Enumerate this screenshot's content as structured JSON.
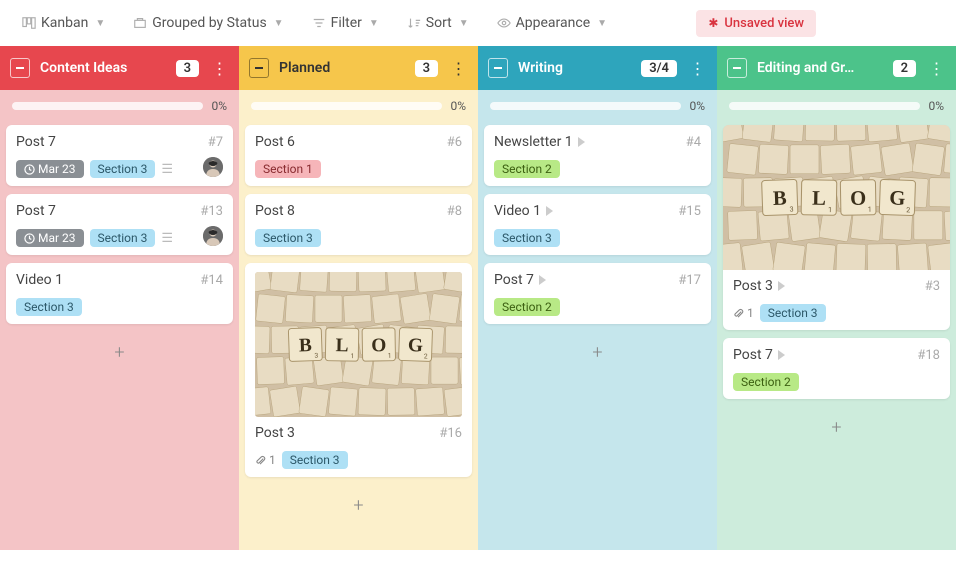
{
  "toolbar": {
    "view_type": "Kanban",
    "group_by": "Grouped by Status",
    "filter": "Filter",
    "sort": "Sort",
    "appearance": "Appearance",
    "unsaved": "Unsaved view"
  },
  "columns": [
    {
      "title": "Content Ideas",
      "count": "3",
      "progress": "0%",
      "color": "red",
      "cards": [
        {
          "title": "Post 7",
          "num": "#7",
          "date": "Mar 23",
          "section": "Section 3",
          "section_color": "blue",
          "desc": true,
          "avatar": true
        },
        {
          "title": "Post 7",
          "num": "#13",
          "date": "Mar 23",
          "section": "Section 3",
          "section_color": "blue",
          "desc": true,
          "avatar": true
        },
        {
          "title": "Video 1",
          "num": "#14",
          "section": "Section 3",
          "section_color": "blue"
        }
      ]
    },
    {
      "title": "Planned",
      "count": "3",
      "progress": "0%",
      "color": "yellow",
      "cards": [
        {
          "title": "Post 6",
          "num": "#6",
          "section": "Section 1",
          "section_color": "red"
        },
        {
          "title": "Post 8",
          "num": "#8",
          "section": "Section 3",
          "section_color": "blue"
        },
        {
          "title": "Post 3",
          "num": "#16",
          "section": "Section 3",
          "section_color": "blue",
          "attach": "1",
          "image": true
        }
      ]
    },
    {
      "title": "Writing",
      "count": "3/4",
      "progress": "0%",
      "color": "teal",
      "cards": [
        {
          "title": "Newsletter 1",
          "num": "#4",
          "section": "Section 2",
          "section_color": "green",
          "play": true
        },
        {
          "title": "Video 1",
          "num": "#15",
          "section": "Section 3",
          "section_color": "blue",
          "play": true
        },
        {
          "title": "Post 7",
          "num": "#17",
          "section": "Section 2",
          "section_color": "green",
          "play": true
        }
      ]
    },
    {
      "title": "Editing and Gr…",
      "count": "2",
      "progress": "0%",
      "color": "green",
      "cards": [
        {
          "title": "Post 3",
          "num": "#3",
          "section": "Section 3",
          "section_color": "blue",
          "attach": "1",
          "image": true,
          "play": true
        },
        {
          "title": "Post 7",
          "num": "#18",
          "section": "Section 2",
          "section_color": "green",
          "play": true
        }
      ]
    }
  ]
}
